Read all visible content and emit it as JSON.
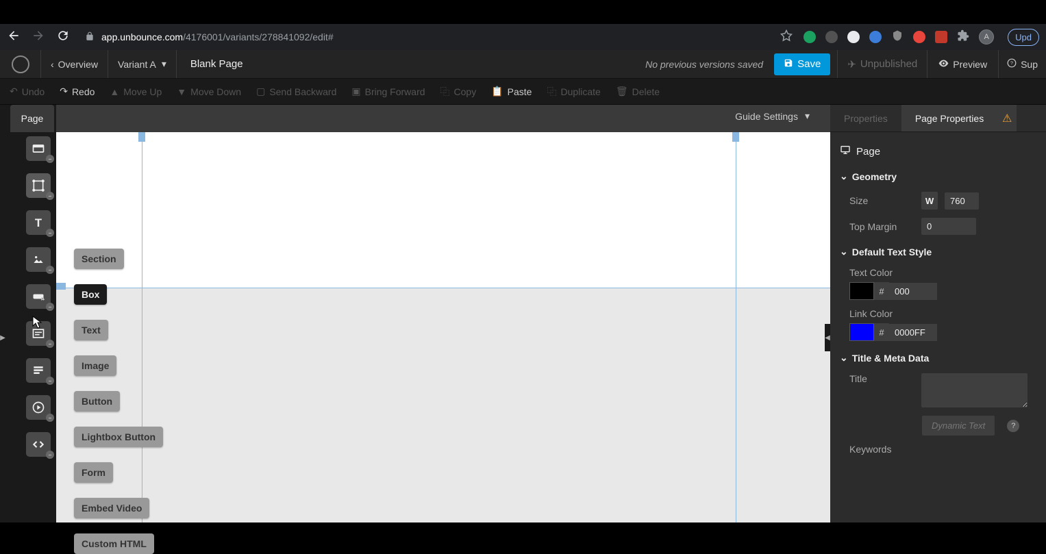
{
  "browser": {
    "url_domain": "app.unbounce.com",
    "url_path": "/4176001/variants/278841092/edit#",
    "avatar_letter": "A",
    "update_label": "Upd"
  },
  "header": {
    "overview": "Overview",
    "variant": "Variant A",
    "page_title": "Blank Page",
    "version_status": "No previous versions saved",
    "save": "Save",
    "unpublished": "Unpublished",
    "preview": "Preview",
    "support": "Sup"
  },
  "actions": {
    "undo": "Undo",
    "redo": "Redo",
    "move_up": "Move Up",
    "move_down": "Move Down",
    "send_backward": "Send Backward",
    "bring_forward": "Bring Forward",
    "copy": "Copy",
    "paste": "Paste",
    "duplicate": "Duplicate",
    "delete": "Delete"
  },
  "page_tab": "Page",
  "guide_settings": "Guide Settings",
  "tools": {
    "section": "Section",
    "box": "Box",
    "text": "Text",
    "image": "Image",
    "button": "Button",
    "lightbox_button": "Lightbox Button",
    "form": "Form",
    "embed_video": "Embed Video",
    "custom_html": "Custom HTML"
  },
  "panel": {
    "tab_properties": "Properties",
    "tab_page_properties": "Page Properties",
    "page_heading": "Page",
    "geometry": "Geometry",
    "size_label": "Size",
    "size_w": "W",
    "size_value": "760",
    "top_margin_label": "Top Margin",
    "top_margin_value": "0",
    "default_text_style": "Default Text Style",
    "text_color_label": "Text Color",
    "text_color_value": "000",
    "text_color_hex": "#000000",
    "link_color_label": "Link Color",
    "link_color_value": "0000FF",
    "link_color_hex": "#0000FF",
    "title_meta": "Title & Meta Data",
    "title_label": "Title",
    "dynamic_text": "Dynamic Text",
    "keywords_label": "Keywords"
  }
}
